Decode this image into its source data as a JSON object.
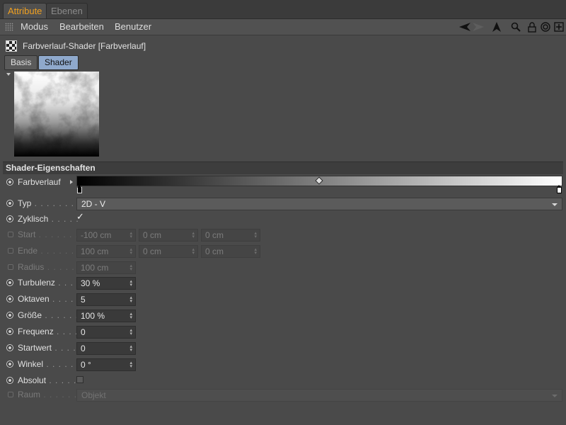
{
  "tabs": {
    "active": "Attribute",
    "inactive": "Ebenen"
  },
  "menu": {
    "modus": "Modus",
    "bearbeiten": "Bearbeiten",
    "benutzer": "Benutzer"
  },
  "toolbar_icons": [
    "back-arrow-icon",
    "forward-arrow-icon",
    "pointer-up-icon",
    "search-icon",
    "lock-icon",
    "target-icon",
    "add-icon"
  ],
  "object": {
    "title": "Farbverlauf-Shader [Farbverlauf]",
    "icon": "checker-icon"
  },
  "section_tabs": {
    "basis": "Basis",
    "shader": "Shader"
  },
  "properties": {
    "header": "Shader-Eigenschaften",
    "farbverlauf": {
      "label": "Farbverlauf",
      "stops": [
        "#000000",
        "#ffffff"
      ]
    },
    "typ": {
      "label": "Typ",
      "dots": " . . . . . . . . . .",
      "value": "2D - V"
    },
    "zyklisch": {
      "label": "Zyklisch",
      "dots": " . . . . .",
      "checked": true
    },
    "start": {
      "label": "Start",
      "dots": " . . . . . . . .",
      "values": [
        "-100 cm",
        "0 cm",
        "0 cm"
      ]
    },
    "ende": {
      "label": "Ende",
      "dots": " . . . . . . . .",
      "values": [
        "100 cm",
        "0 cm",
        "0 cm"
      ]
    },
    "radius": {
      "label": "Radius",
      "dots": " . . . . . .",
      "value": "100 cm"
    },
    "turbulenz": {
      "label": "Turbulenz",
      "dots": " . . . .",
      "value": "30 %"
    },
    "oktaven": {
      "label": "Oktaven",
      "dots": " . . . . .",
      "value": "5"
    },
    "groesse": {
      "label": "Größe",
      "dots": " . . . . . . .",
      "value": "100 %"
    },
    "frequenz": {
      "label": "Frequenz",
      "dots": " . . . .",
      "value": "0"
    },
    "startwert": {
      "label": "Startwert",
      "dots": " . . . .",
      "value": "0"
    },
    "winkel": {
      "label": "Winkel",
      "dots": " . . . . . .",
      "value": "0 °"
    },
    "absolut": {
      "label": "Absolut",
      "dots": " . . . . . .",
      "checked": false
    },
    "raum": {
      "label": "Raum",
      "dots": " . . . . . . . .",
      "value": "Objekt"
    }
  },
  "colors": {
    "accent": "#f0a020",
    "panel": "#4a4a4a",
    "selected_tab": "#8fa9cc"
  }
}
